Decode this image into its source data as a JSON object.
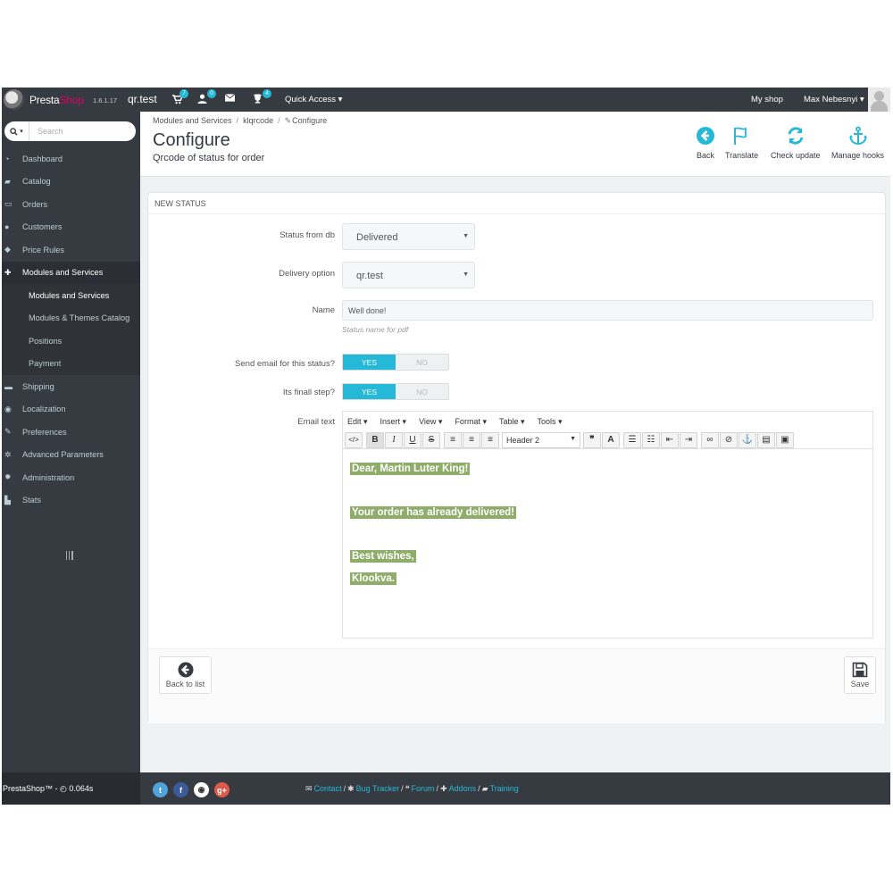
{
  "topbar": {
    "brand_a": "Presta",
    "brand_b": "Shop",
    "version": "1.6.1.17",
    "shop_name": "qr.test",
    "badges": {
      "orders": "7",
      "customers": "0",
      "messages": "",
      "trophy": "4"
    },
    "quick_access": "Quick Access ▾",
    "my_shop": "My shop",
    "user": "Max Nebesnyi ▾"
  },
  "sidebar": {
    "search_placeholder": "Search",
    "items": [
      {
        "label": "Dashboard",
        "icon": "dashboard-icon"
      },
      {
        "label": "Catalog",
        "icon": "book-icon"
      },
      {
        "label": "Orders",
        "icon": "credit-card-icon"
      },
      {
        "label": "Customers",
        "icon": "users-icon"
      },
      {
        "label": "Price Rules",
        "icon": "tags-icon"
      },
      {
        "label": "Modules and Services",
        "icon": "puzzle-icon"
      }
    ],
    "subitems": [
      {
        "label": "Modules and Services"
      },
      {
        "label": "Modules & Themes Catalog"
      },
      {
        "label": "Positions"
      },
      {
        "label": "Payment"
      }
    ],
    "items_after": [
      {
        "label": "Shipping",
        "icon": "truck-icon"
      },
      {
        "label": "Localization",
        "icon": "globe-icon"
      },
      {
        "label": "Preferences",
        "icon": "wrench-icon"
      },
      {
        "label": "Advanced Parameters",
        "icon": "cogs-icon"
      },
      {
        "label": "Administration",
        "icon": "cog-icon"
      },
      {
        "label": "Stats",
        "icon": "bar-chart-icon"
      }
    ],
    "footer": "PrestaShop™ - ◴ 0.064s"
  },
  "header": {
    "breadcrumb": [
      "Modules and Services",
      "klqrcode",
      "Configure"
    ],
    "title": "Configure",
    "subtitle": "Qrcode of status for order",
    "tools": [
      {
        "label": "Back",
        "icon": "back-circle-icon"
      },
      {
        "label": "Translate",
        "icon": "flag-icon"
      },
      {
        "label": "Check update",
        "icon": "refresh-icon"
      },
      {
        "label": "Manage hooks",
        "icon": "anchor-icon"
      }
    ]
  },
  "panel": {
    "heading": "NEW STATUS",
    "status_label": "Status from db",
    "status_value": "Delivered",
    "delivery_label": "Delivery option",
    "delivery_value": "qr.test",
    "name_label": "Name",
    "name_value": "Well done!",
    "name_help": "Status name for pdf",
    "send_email_label": "Send email for this status?",
    "final_step_label": "Its finall step?",
    "yes": "YES",
    "no": "NO",
    "email_label": "Email text",
    "editor_menus": [
      "Edit ▾",
      "Insert ▾",
      "View ▾",
      "Format ▾",
      "Table ▾",
      "Tools ▾"
    ],
    "format_select": "Header 2",
    "email_lines": [
      "Dear, Martin Luter King!",
      "",
      "Your order has already delivered!",
      "",
      "Best wishes,",
      "Klookva."
    ],
    "back_to_list": "Back to list",
    "save": "Save"
  },
  "footer": {
    "links": [
      "Contact",
      "Bug Tracker",
      "Forum",
      "Addons",
      "Training"
    ]
  },
  "colors": {
    "dark": "#363a41",
    "accent": "#25b9d7",
    "brand_pink": "#df0067",
    "highlight_green": "#8fad6a"
  }
}
